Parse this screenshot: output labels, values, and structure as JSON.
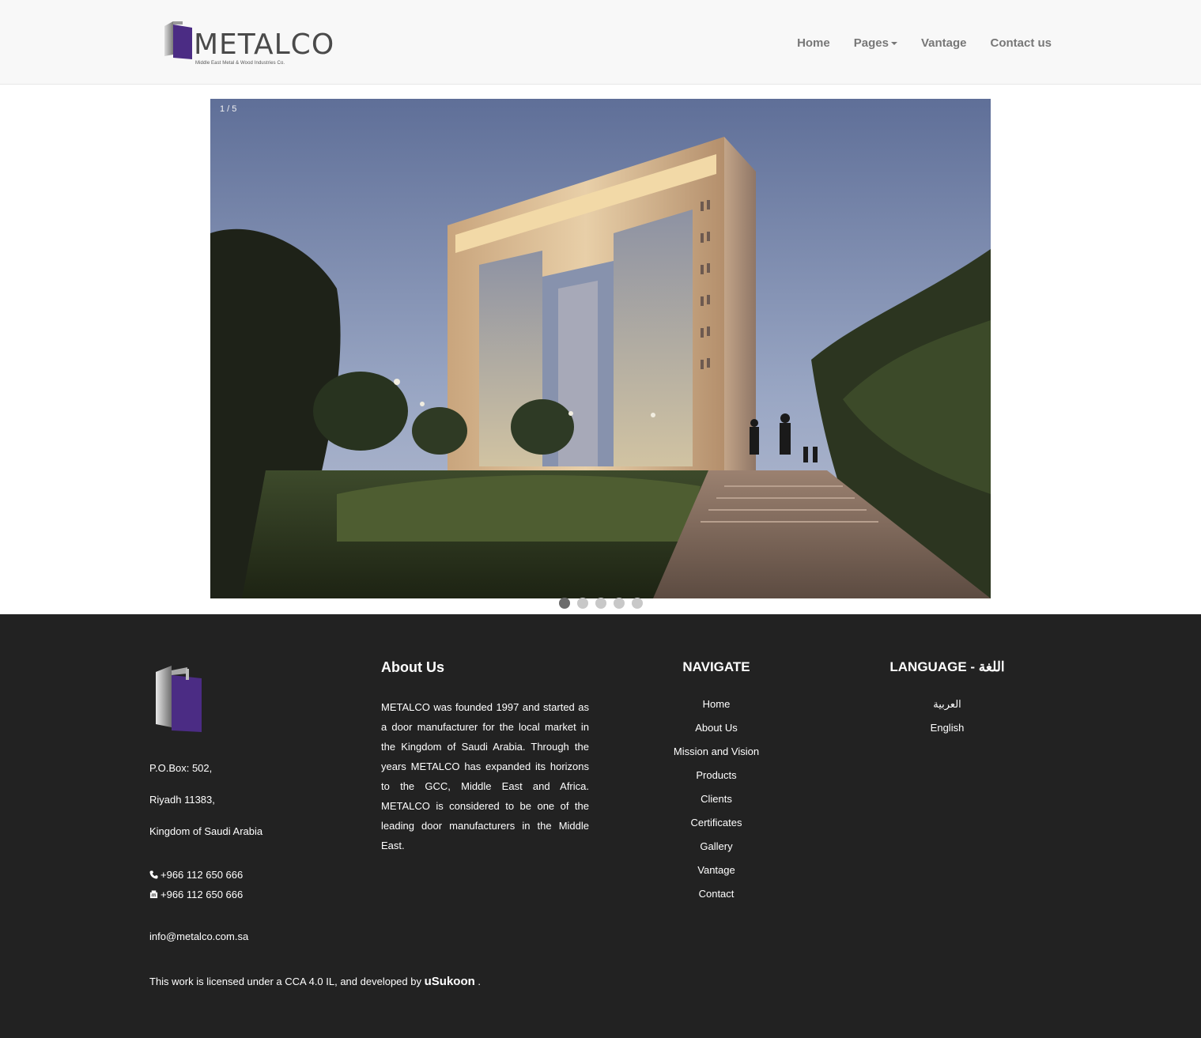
{
  "header": {
    "logo_word": "METALCO",
    "logo_tagline": "Middle East Metal & Wood Industries Co.",
    "nav": [
      {
        "label": "Home"
      },
      {
        "label": "Pages"
      },
      {
        "label": "Vantage"
      },
      {
        "label": "Contact us"
      }
    ]
  },
  "slider": {
    "counter": "1 / 5",
    "slide_count": 5,
    "active_slide": 1
  },
  "footer": {
    "address": {
      "line1": "P.O.Box: 502,",
      "line2": "Riyadh 11383,",
      "line3": "Kingdom of Saudi Arabia",
      "phone": "+966 112 650 666",
      "fax": "+966 112 650 666",
      "email": "info@metalco.com.sa"
    },
    "about": {
      "title": "About Us",
      "text": "METALCO was founded 1997 and started as a door manufacturer for the local market in the Kingdom of Saudi Arabia. Through the years METALCO has expanded its horizons to the GCC, Middle East and Africa. METALCO is considered to be one of the leading door manufacturers in the Middle East."
    },
    "navigate": {
      "title": "NAVIGATE",
      "links": [
        "Home",
        "About Us",
        "Mission and Vision",
        "Products",
        "Clients",
        "Certificates",
        "Gallery",
        "Vantage",
        "Contact"
      ]
    },
    "language": {
      "title": "LANGUAGE - اللغة",
      "links": [
        "العربية",
        "English"
      ]
    },
    "license": {
      "text": "This work is licensed under a CCA 4.0 IL, and developed by",
      "developer": "uSukoon",
      "end": "."
    }
  },
  "colors": {
    "brand_purple": "#4b2c84",
    "footer_bg": "#222222",
    "navbar_bg": "#f8f8f8"
  }
}
